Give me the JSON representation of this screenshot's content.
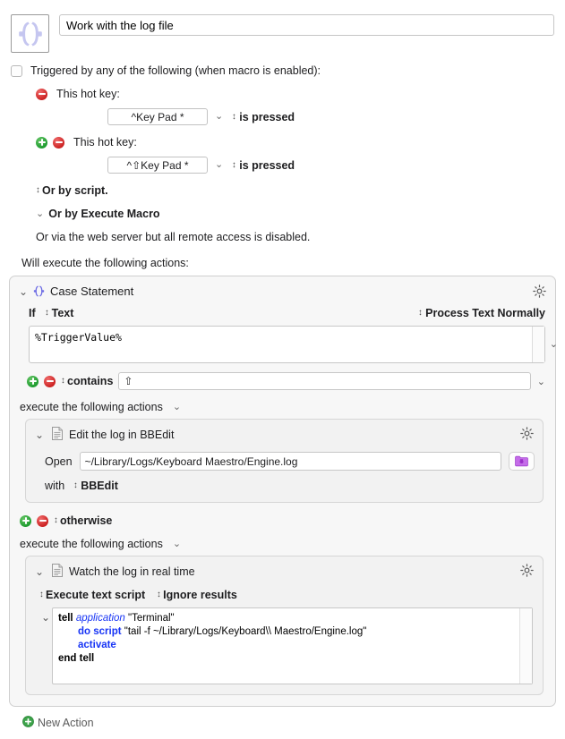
{
  "macro": {
    "icon_name": "curly-braces-icon",
    "name": "Work with the log file"
  },
  "triggers": {
    "checkbox_label": "Triggered by any of the following (when macro is enabled):",
    "checked": false,
    "items": [
      {
        "label": "This hot key:",
        "hotkey": "^Key Pad *",
        "condition": "is pressed",
        "has_add": false
      },
      {
        "label": "This hot key:",
        "hotkey": "^⇧Key Pad *",
        "condition": "is pressed",
        "has_add": true
      }
    ],
    "or_script": "Or by script.",
    "or_execute_macro": "Or by Execute Macro",
    "web_server_note": "Or via the web server but all remote access is disabled."
  },
  "actions_header": "Will execute the following actions:",
  "case_statement": {
    "title": "Case Statement",
    "icon_name": "curly-braces-icon",
    "if_label": "If",
    "if_source": "Text",
    "process_mode": "Process Text Normally",
    "text_value": "%TriggerValue%",
    "condition_operator": "contains",
    "condition_value": "⇧",
    "then_exec_label": "execute the following actions",
    "otherwise_label": "otherwise",
    "otherwise_exec_label": "execute the following actions",
    "then_action": {
      "title": "Edit the log in BBEdit",
      "icon_name": "script-document-icon",
      "open_label": "Open",
      "open_path": "~/Library/Logs/Keyboard Maestro/Engine.log",
      "with_label": "with",
      "with_app": "BBEdit",
      "folder_button_name": "choose-file-button"
    },
    "otherwise_action": {
      "title": "Watch the log in real time",
      "icon_name": "script-document-icon",
      "script_kind": "Execute text script",
      "results_mode": "Ignore results",
      "script_lines": [
        {
          "indent": 0,
          "parts": [
            {
              "t": "tell ",
              "c": "kw"
            },
            {
              "t": "application ",
              "c": "it-blue"
            },
            {
              "t": "\"Terminal\"",
              "c": "str"
            }
          ]
        },
        {
          "indent": 1,
          "parts": [
            {
              "t": "do script ",
              "c": "kw-blue"
            },
            {
              "t": "\"tail -f ~/Library/Logs/Keyboard\\\\ Maestro/Engine.log\"",
              "c": "str"
            }
          ]
        },
        {
          "indent": 1,
          "parts": [
            {
              "t": "activate",
              "c": "kw-blue"
            }
          ]
        },
        {
          "indent": 0,
          "parts": [
            {
              "t": "end tell",
              "c": "kw"
            }
          ]
        }
      ]
    }
  },
  "new_action": {
    "label": "New Action",
    "icon_name": "plus-circle-icon"
  },
  "colors": {
    "accent_purple": "#c5c6f0",
    "case_icon_purple": "#6d6ce4",
    "add_green": "#27a02e",
    "remove_red": "#cc2222",
    "script_blue": "#1734f5",
    "folder_purple": "#b45ae0"
  }
}
